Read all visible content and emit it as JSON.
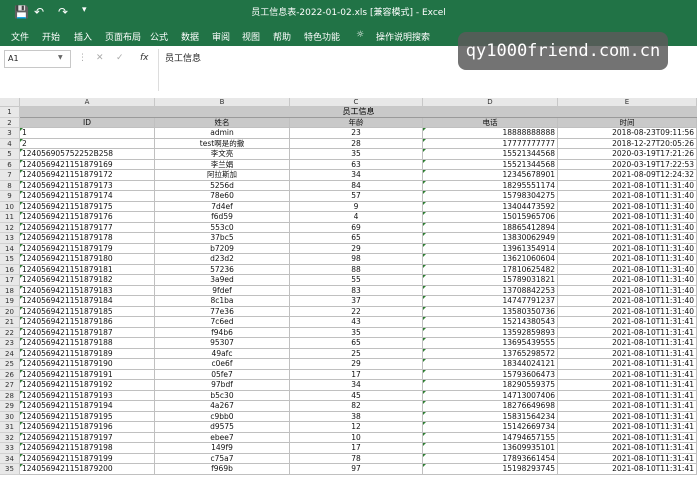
{
  "titlebar": {
    "title": "员工信息表-2022-01-02.xls  [兼容模式]  -  Excel"
  },
  "menu": [
    "文件",
    "开始",
    "插入",
    "页面布局",
    "公式",
    "数据",
    "审阅",
    "视图",
    "帮助",
    "特色功能",
    "操作说明搜索"
  ],
  "watermark": "qy1000friend.com.cn",
  "namebox": "A1",
  "formula": "员工信息",
  "columns": [
    "A",
    "B",
    "C",
    "D",
    "E"
  ],
  "merged_title": "员工信息",
  "headers": [
    "ID",
    "姓名",
    "年龄",
    "电话",
    "时间"
  ],
  "rows": [
    [
      "1",
      "admin",
      "23",
      "18888888888",
      "2018-08-23T09:11:56"
    ],
    [
      "2",
      "test啊是的撒",
      "28",
      "17777777777",
      "2018-12-27T20:05:26"
    ],
    [
      "124056905752252B258",
      "李文亮",
      "35",
      "15521344568",
      "2020-03-19T17:21:26"
    ],
    [
      "1240569421151879169",
      "李兰娟",
      "63",
      "15521344568",
      "2020-03-19T17:22:53"
    ],
    [
      "1240569421151879172",
      "阿拉斯加",
      "34",
      "12345678901",
      "2021-08-09T12:24:32"
    ],
    [
      "1240569421151879173",
      "5256d",
      "84",
      "18295551174",
      "2021-08-10T11:31:40"
    ],
    [
      "1240569421151879174",
      "78e60",
      "57",
      "15798304275",
      "2021-08-10T11:31:40"
    ],
    [
      "1240569421151879175",
      "7d4ef",
      "9",
      "13404473592",
      "2021-08-10T11:31:40"
    ],
    [
      "1240569421151879176",
      "f6d59",
      "4",
      "15015965706",
      "2021-08-10T11:31:40"
    ],
    [
      "1240569421151879177",
      "553c0",
      "69",
      "18865412894",
      "2021-08-10T11:31:40"
    ],
    [
      "1240569421151879178",
      "37bc5",
      "65",
      "13830062949",
      "2021-08-10T11:31:40"
    ],
    [
      "1240569421151879179",
      "b7209",
      "29",
      "13961354914",
      "2021-08-10T11:31:40"
    ],
    [
      "1240569421151879180",
      "d23d2",
      "98",
      "13621060604",
      "2021-08-10T11:31:40"
    ],
    [
      "1240569421151879181",
      "57236",
      "88",
      "17810625482",
      "2021-08-10T11:31:40"
    ],
    [
      "1240569421151879182",
      "3a9ed",
      "55",
      "15789031821",
      "2021-08-10T11:31:40"
    ],
    [
      "1240569421151879183",
      "9fdef",
      "83",
      "13708842253",
      "2021-08-10T11:31:40"
    ],
    [
      "1240569421151879184",
      "8c1ba",
      "37",
      "14747791237",
      "2021-08-10T11:31:40"
    ],
    [
      "1240569421151879185",
      "77e36",
      "22",
      "13580350736",
      "2021-08-10T11:31:40"
    ],
    [
      "1240569421151879186",
      "7c6ed",
      "43",
      "15214380543",
      "2021-08-10T11:31:41"
    ],
    [
      "1240569421151879187",
      "f94b6",
      "35",
      "13592859893",
      "2021-08-10T11:31:41"
    ],
    [
      "1240569421151879188",
      "95307",
      "65",
      "13695439555",
      "2021-08-10T11:31:41"
    ],
    [
      "1240569421151879189",
      "49afc",
      "25",
      "13765298572",
      "2021-08-10T11:31:41"
    ],
    [
      "1240569421151879190",
      "c0e6f",
      "29",
      "18344024121",
      "2021-08-10T11:31:41"
    ],
    [
      "1240569421151879191",
      "05fe7",
      "17",
      "15793606473",
      "2021-08-10T11:31:41"
    ],
    [
      "1240569421151879192",
      "97bdf",
      "34",
      "18290559375",
      "2021-08-10T11:31:41"
    ],
    [
      "1240569421151879193",
      "b5c30",
      "45",
      "14713007406",
      "2021-08-10T11:31:41"
    ],
    [
      "1240569421151879194",
      "4a267",
      "82",
      "18276649698",
      "2021-08-10T11:31:41"
    ],
    [
      "1240569421151879195",
      "c9bb0",
      "38",
      "15831564234",
      "2021-08-10T11:31:41"
    ],
    [
      "1240569421151879196",
      "d9575",
      "12",
      "15142669734",
      "2021-08-10T11:31:41"
    ],
    [
      "1240569421151879197",
      "ebee7",
      "10",
      "14794657155",
      "2021-08-10T11:31:41"
    ],
    [
      "1240569421151879198",
      "149f9",
      "17",
      "13609935101",
      "2021-08-10T11:31:41"
    ],
    [
      "1240569421151879199",
      "c75a7",
      "78",
      "17893661454",
      "2021-08-10T11:31:41"
    ],
    [
      "1240569421151879200",
      "f969b",
      "97",
      "15198293745",
      "2021-08-10T11:31:41"
    ]
  ],
  "colors": {
    "excel_green": "#217346",
    "header_fill": "#c9c9c9"
  }
}
